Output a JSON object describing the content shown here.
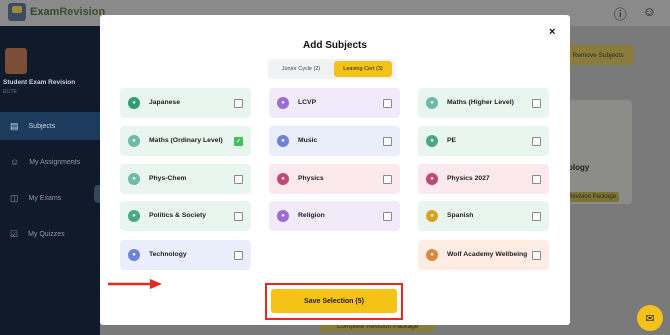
{
  "app": {
    "logo_text_a": "Exam",
    "logo_text_b": "Revision",
    "student_name": "Student Exam Revision",
    "student_sub": "ELITE"
  },
  "sidebar": {
    "items": [
      {
        "label": "Subjects",
        "icon": "book-icon",
        "active": true
      },
      {
        "label": "My Assignments",
        "icon": "users-icon",
        "active": false
      },
      {
        "label": "My Exams",
        "icon": "open-book-icon",
        "active": false
      },
      {
        "label": "My Quizzes",
        "icon": "checkbox-icon",
        "active": false
      }
    ]
  },
  "background": {
    "remove_subjects": "Remove Subjects",
    "card_title": "ology",
    "card_package": "Revision Package",
    "complete_package": "Complete Revision Package"
  },
  "modal": {
    "title": "Add Subjects",
    "close_label": "×",
    "tabs": [
      {
        "label": "Junior Cycle (2)",
        "active": false
      },
      {
        "label": "Leaving Cert (3)",
        "active": true
      }
    ],
    "subjects": [
      {
        "label": "Japanese",
        "checked": false,
        "color": "#e9f6ef",
        "icon_color": "#2f9c72"
      },
      {
        "label": "LCVP",
        "checked": false,
        "color": "#f1ebf9",
        "icon_color": "#9b6bd8"
      },
      {
        "label": "Maths (Higher Level)",
        "checked": false,
        "color": "#e9f6ef",
        "icon_color": "#6fb9a6"
      },
      {
        "label": "Maths (Ordinary Level)",
        "checked": true,
        "color": "#e9f6ef",
        "icon_color": "#6fb9a6"
      },
      {
        "label": "Music",
        "checked": false,
        "color": "#eaedfa",
        "icon_color": "#6e83d6"
      },
      {
        "label": "PE",
        "checked": false,
        "color": "#e9f6ef",
        "icon_color": "#4aa882"
      },
      {
        "label": "Phys-Chem",
        "checked": false,
        "color": "#e9f6ef",
        "icon_color": "#6fb9a6"
      },
      {
        "label": "Physics",
        "checked": false,
        "color": "#fbe9ee",
        "icon_color": "#c24775"
      },
      {
        "label": "Physics 2027",
        "checked": false,
        "color": "#fbe9ee",
        "icon_color": "#c24775"
      },
      {
        "label": "Politics & Society",
        "checked": false,
        "color": "#e9f6ef",
        "icon_color": "#4aa882"
      },
      {
        "label": "Religion",
        "checked": false,
        "color": "#f1ebf9",
        "icon_color": "#9b6bd8"
      },
      {
        "label": "Spanish",
        "checked": false,
        "color": "#e9f6ef",
        "icon_color": "#d9a320"
      },
      {
        "label": "Technology",
        "checked": false,
        "color": "#eaedfa",
        "icon_color": "#6e83d6"
      },
      {
        "label": "Wolf Academy Wellbeing",
        "checked": false,
        "color": "#fdece3",
        "icon_color": "#d98a3c"
      }
    ],
    "save_label": "Save Selection (5)"
  },
  "chat_icon": "chat-bubble-icon"
}
